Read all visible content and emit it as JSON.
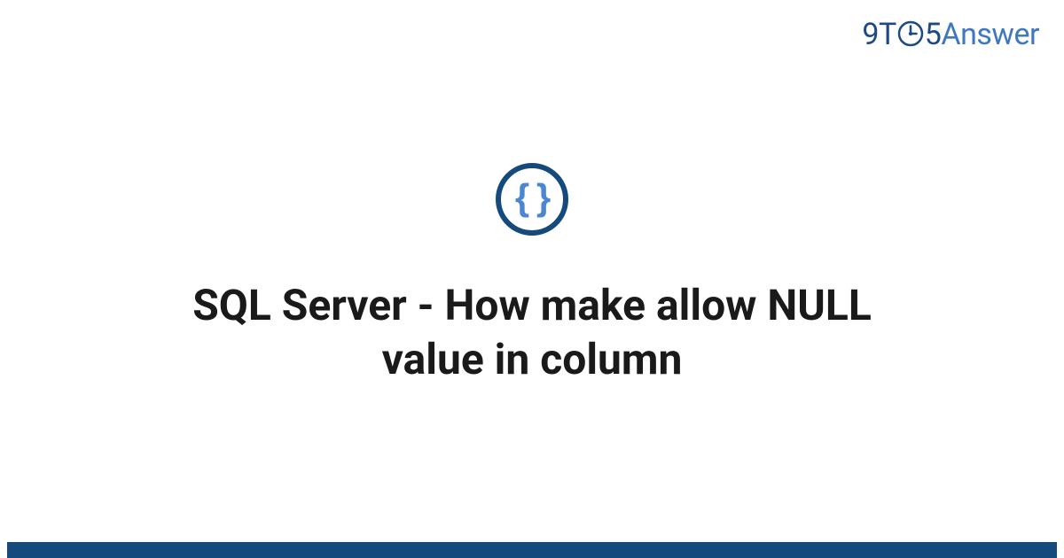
{
  "header": {
    "logo": {
      "part1": "9T",
      "part2": "5",
      "part3": "Answer"
    }
  },
  "main": {
    "icon_name": "code-braces-icon",
    "icon_content": "{ }",
    "title": "SQL Server - How make allow NULL value in column"
  },
  "colors": {
    "brand_dark": "#154a7d",
    "brand_light": "#4b87d0",
    "logo_dark": "#1b4a84",
    "logo_light": "#3f78c2",
    "text": "#1a1a1a"
  }
}
